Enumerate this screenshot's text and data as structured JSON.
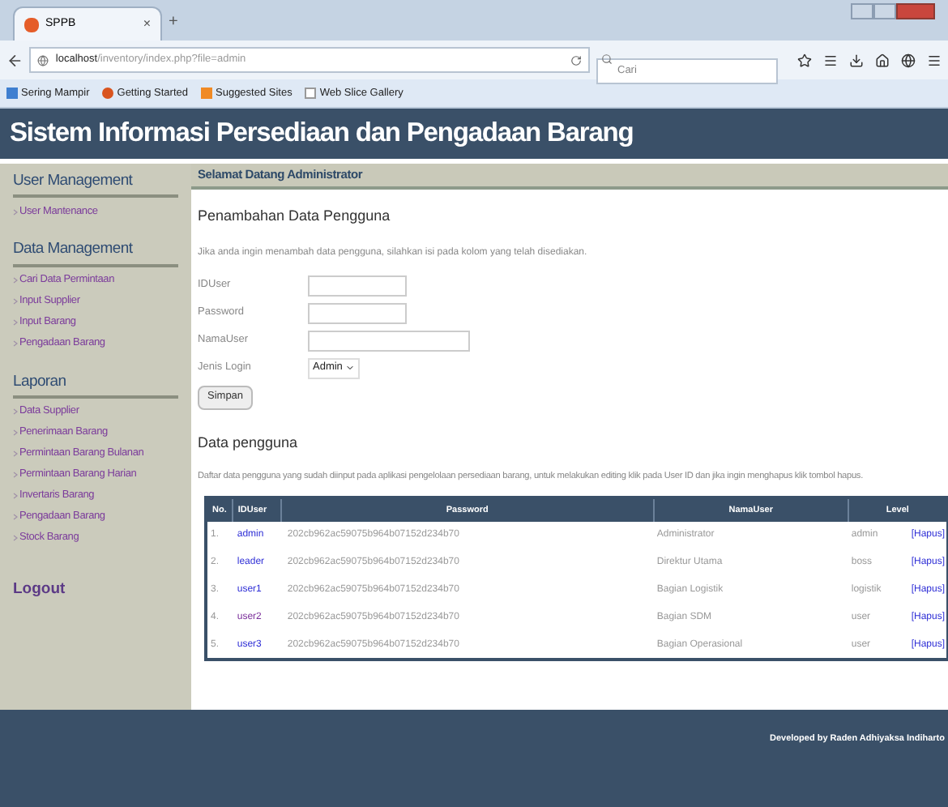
{
  "browser": {
    "tab": {
      "title": "SPPB",
      "close": "×"
    },
    "new_tab": "+",
    "address": {
      "host": "localhost",
      "path": "/inventory/index.php?file=admin"
    },
    "search": {
      "placeholder": "Cari"
    },
    "bookmarks": [
      "Sering Mampir",
      "Getting Started",
      "Suggested Sites",
      "Web Slice Gallery"
    ]
  },
  "header": {
    "title": "Sistem Informasi Persediaan dan Pengadaan Barang"
  },
  "sidebar": [
    {
      "heading": "User Management",
      "items": [
        "User Mantenance"
      ]
    },
    {
      "heading": "Data Management",
      "items": [
        "Cari Data Permintaan",
        "Input Supplier",
        "Input Barang",
        "Pengadaan Barang"
      ]
    },
    {
      "heading": "Laporan",
      "items": [
        "Data Supplier",
        "Penerimaan Barang",
        "Permintaan Barang Bulanan",
        "Permintaan Barang Harian",
        "Invertaris Barang",
        "Pengadaan Barang",
        "Stock Barang"
      ]
    }
  ],
  "logout": "Logout",
  "welcome": "Selamat Datang Administrator",
  "form": {
    "title": "Penambahan Data Pengguna",
    "intro": "Jika anda ingin menambah data pengguna, silahkan isi pada kolom yang telah disediakan.",
    "fields": [
      {
        "kind": "text",
        "label": "IDUser"
      },
      {
        "kind": "text",
        "label": "Password"
      },
      {
        "kind": "wide",
        "label": "NamaUser"
      },
      {
        "kind": "select",
        "label": "Jenis Login",
        "value": "Admin"
      }
    ],
    "submit": "Simpan"
  },
  "list": {
    "title": "Data pengguna",
    "intro": "Daftar data pengguna yang sudah diinput pada aplikasi pengelolaan persediaan barang, untuk melakukan editing klik pada User ID dan jika ingin menghapus klik tombol hapus.",
    "columns": [
      "No.",
      "IDUser",
      "Password",
      "NamaUser",
      "Level"
    ],
    "rows": [
      {
        "no": "1.",
        "id": "admin",
        "visited": false,
        "password": "202cb962ac59075b964b07152d234b70",
        "name": "Administrator",
        "level": "admin",
        "action": "[Hapus]"
      },
      {
        "no": "2.",
        "id": "leader",
        "visited": false,
        "password": "202cb962ac59075b964b07152d234b70",
        "name": "Direktur Utama",
        "level": "boss",
        "action": "[Hapus]"
      },
      {
        "no": "3.",
        "id": "user1",
        "visited": false,
        "password": "202cb962ac59075b964b07152d234b70",
        "name": "Bagian Logistik",
        "level": "logistik",
        "action": "[Hapus]"
      },
      {
        "no": "4.",
        "id": "user2",
        "visited": true,
        "password": "202cb962ac59075b964b07152d234b70",
        "name": "Bagian SDM",
        "level": "user",
        "action": "[Hapus]"
      },
      {
        "no": "5.",
        "id": "user3",
        "visited": false,
        "password": "202cb962ac59075b964b07152d234b70",
        "name": "Bagian Operasional",
        "level": "user",
        "action": "[Hapus]"
      }
    ]
  },
  "footer": "Developed by Raden Adhiyaksa Indiharto"
}
